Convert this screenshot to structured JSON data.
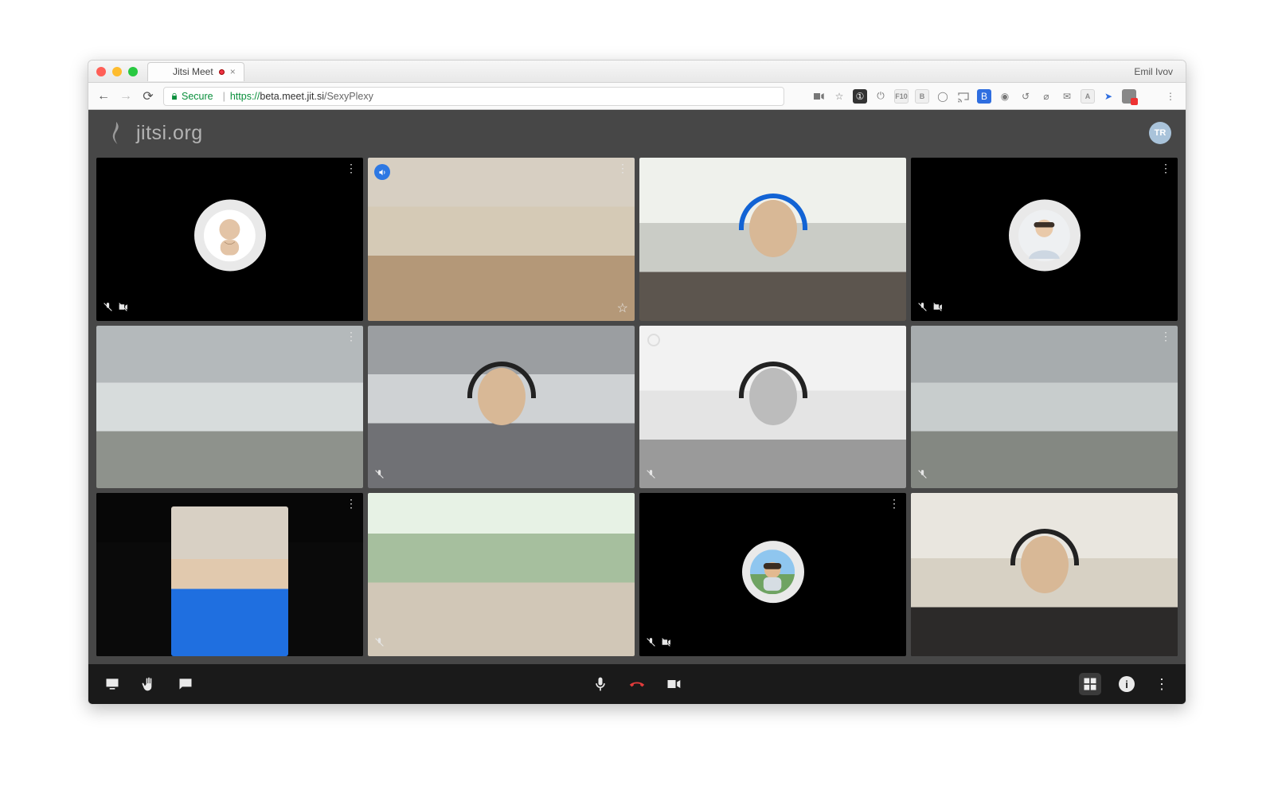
{
  "os_user": "Emil Ivov",
  "browser_tab": {
    "title": "Jitsi Meet",
    "recording": true
  },
  "address_bar": {
    "secure_label": "Secure",
    "protocol": "https://",
    "host": "beta.meet.jit.si",
    "path": "/SexyPlexy"
  },
  "app": {
    "logo_text": "jitsi.org",
    "local_avatar_initials": "TR"
  },
  "participants": [
    {
      "id": 0,
      "display_mode": "avatar",
      "avatar_shape": "bald-man",
      "mic_muted": true,
      "cam_muted": true,
      "active_speaker": false,
      "dominant": false,
      "starred": false,
      "menu": true
    },
    {
      "id": 1,
      "display_mode": "video",
      "video_style": "ph-a",
      "mic_muted": false,
      "cam_muted": false,
      "active_speaker": true,
      "dominant": false,
      "starred": true,
      "menu": true
    },
    {
      "id": 2,
      "display_mode": "video",
      "video_style": "ph-b",
      "mic_muted": false,
      "cam_muted": false,
      "active_speaker": false,
      "dominant": false,
      "starred": false,
      "menu": false,
      "headset": "blue"
    },
    {
      "id": 3,
      "display_mode": "avatar",
      "avatar_shape": "suit-man",
      "mic_muted": true,
      "cam_muted": true,
      "active_speaker": false,
      "dominant": false,
      "starred": false,
      "menu": true
    },
    {
      "id": 4,
      "display_mode": "video",
      "video_style": "ph-c",
      "mic_muted": false,
      "cam_muted": false,
      "active_speaker": false,
      "dominant": false,
      "starred": false,
      "menu": true
    },
    {
      "id": 5,
      "display_mode": "video",
      "video_style": "ph-d",
      "mic_muted": true,
      "cam_muted": false,
      "active_speaker": false,
      "dominant": false,
      "starred": false,
      "menu": false,
      "headset": "black"
    },
    {
      "id": 6,
      "display_mode": "video",
      "video_style": "ph-e",
      "mic_muted": true,
      "cam_muted": false,
      "active_speaker": false,
      "dominant": true,
      "starred": false,
      "menu": false,
      "headset": "black"
    },
    {
      "id": 7,
      "display_mode": "video",
      "video_style": "ph-c2",
      "mic_muted": true,
      "cam_muted": false,
      "active_speaker": false,
      "dominant": false,
      "starred": false,
      "menu": true
    },
    {
      "id": 8,
      "display_mode": "video",
      "video_style": "ph-f",
      "mic_muted": false,
      "cam_muted": false,
      "active_speaker": false,
      "dominant": false,
      "starred": false,
      "menu": true,
      "portrait": true
    },
    {
      "id": 9,
      "display_mode": "video",
      "video_style": "ph-g",
      "mic_muted": true,
      "cam_muted": false,
      "active_speaker": false,
      "dominant": false,
      "starred": false,
      "menu": false
    },
    {
      "id": 10,
      "display_mode": "avatar",
      "avatar_shape": "outdoor-man",
      "mic_muted": true,
      "cam_muted": true,
      "active_speaker": false,
      "dominant": false,
      "starred": false,
      "menu": true
    },
    {
      "id": 11,
      "display_mode": "video",
      "video_style": "ph-h",
      "mic_muted": false,
      "cam_muted": false,
      "active_speaker": false,
      "dominant": false,
      "starred": false,
      "menu": false,
      "headset": "black"
    }
  ],
  "toolbox": {
    "left": [
      "screen-share",
      "raise-hand",
      "chat"
    ],
    "center": [
      "microphone",
      "hangup",
      "camera"
    ],
    "right": [
      "tile-view",
      "info",
      "more"
    ]
  }
}
